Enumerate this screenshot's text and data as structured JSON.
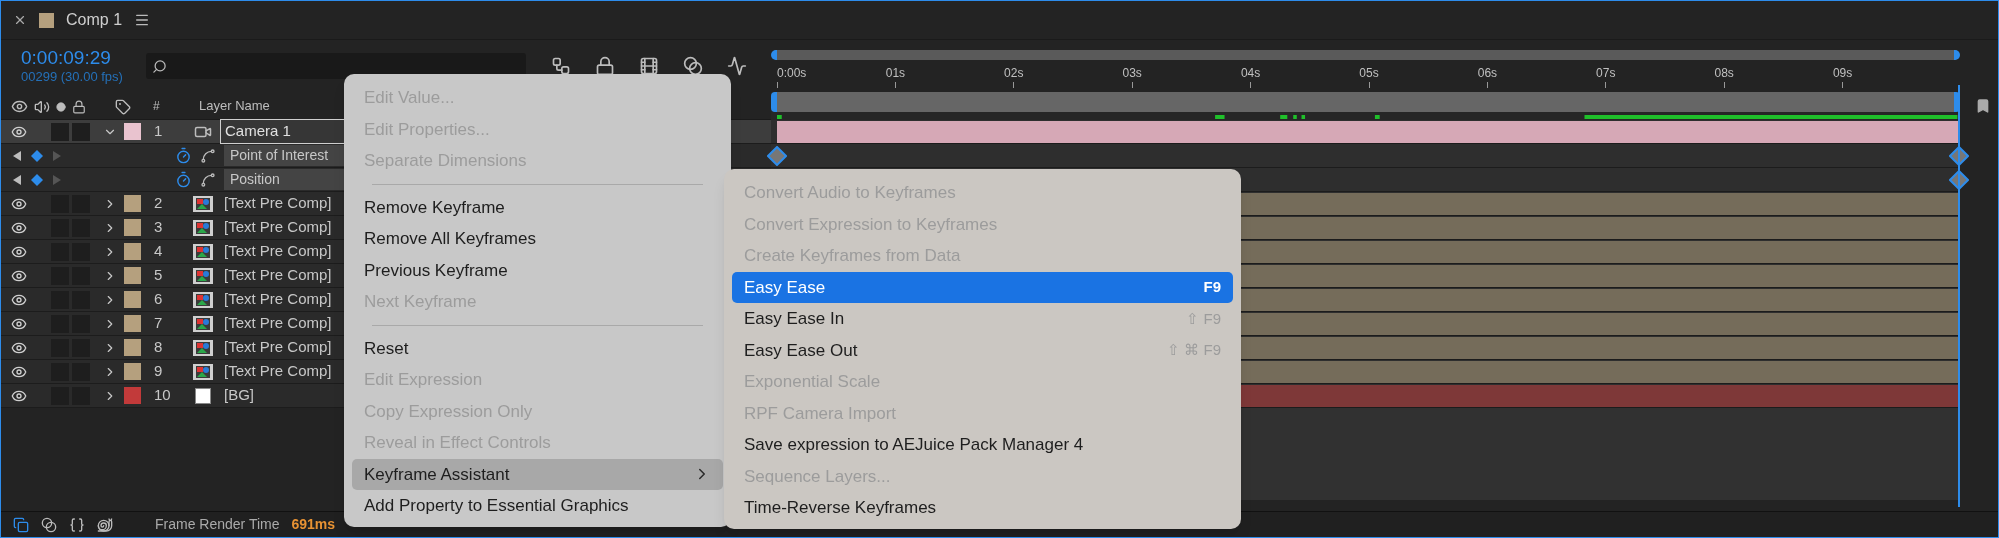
{
  "panel": {
    "title": "Comp 1"
  },
  "timecode": "0:00:09:29",
  "frame_info": "00299 (30.00 fps)",
  "columns": {
    "number": "#",
    "layer_name": "Layer Name"
  },
  "ruler": [
    "0:00s",
    "01s",
    "02s",
    "03s",
    "04s",
    "05s",
    "06s",
    "07s",
    "08s",
    "09s"
  ],
  "layers": [
    {
      "number": "1",
      "name": "Camera 1",
      "kind": "camera",
      "color": "#e9c3cf",
      "selected": true,
      "expanded": true,
      "properties": [
        {
          "name": "Point of Interest"
        },
        {
          "name": "Position"
        }
      ]
    },
    {
      "number": "2",
      "name": "[Text Pre Comp]",
      "kind": "precomp",
      "color": "#b5a07e",
      "selected": false,
      "expanded": false
    },
    {
      "number": "3",
      "name": "[Text Pre Comp]",
      "kind": "precomp",
      "color": "#b5a07e",
      "selected": false,
      "expanded": false
    },
    {
      "number": "4",
      "name": "[Text Pre Comp]",
      "kind": "precomp",
      "color": "#b5a07e",
      "selected": false,
      "expanded": false
    },
    {
      "number": "5",
      "name": "[Text Pre Comp]",
      "kind": "precomp",
      "color": "#b5a07e",
      "selected": false,
      "expanded": false
    },
    {
      "number": "6",
      "name": "[Text Pre Comp]",
      "kind": "precomp",
      "color": "#b5a07e",
      "selected": false,
      "expanded": false
    },
    {
      "number": "7",
      "name": "[Text Pre Comp]",
      "kind": "precomp",
      "color": "#b5a07e",
      "selected": false,
      "expanded": false
    },
    {
      "number": "8",
      "name": "[Text Pre Comp]",
      "kind": "precomp",
      "color": "#b5a07e",
      "selected": false,
      "expanded": false
    },
    {
      "number": "9",
      "name": "[Text Pre Comp]",
      "kind": "precomp",
      "color": "#b5a07e",
      "selected": false,
      "expanded": false
    },
    {
      "number": "10",
      "name": "[BG]",
      "kind": "solid",
      "color": "#c23a3a",
      "selected": false,
      "expanded": false
    }
  ],
  "status_bar": {
    "label": "Frame Render Time",
    "value": "691ms"
  },
  "context_menu": {
    "items": [
      {
        "kind": "item",
        "label": "Edit Value...",
        "disabled": true,
        "selected": false
      },
      {
        "kind": "item",
        "label": "Edit Properties...",
        "disabled": true,
        "selected": false
      },
      {
        "kind": "item",
        "label": "Separate Dimensions",
        "disabled": true,
        "selected": false
      },
      {
        "kind": "separator"
      },
      {
        "kind": "item",
        "label": "Remove Keyframe",
        "disabled": false,
        "selected": false
      },
      {
        "kind": "item",
        "label": "Remove All Keyframes",
        "disabled": false,
        "selected": false
      },
      {
        "kind": "item",
        "label": "Previous Keyframe",
        "disabled": false,
        "selected": false
      },
      {
        "kind": "item",
        "label": "Next Keyframe",
        "disabled": true,
        "selected": false
      },
      {
        "kind": "separator"
      },
      {
        "kind": "item",
        "label": "Reset",
        "disabled": false,
        "selected": false
      },
      {
        "kind": "item",
        "label": "Edit Expression",
        "disabled": true,
        "selected": false
      },
      {
        "kind": "item",
        "label": "Copy Expression Only",
        "disabled": true,
        "selected": false
      },
      {
        "kind": "item",
        "label": "Reveal in Effect Controls",
        "disabled": true,
        "selected": false
      },
      {
        "kind": "submenu",
        "label": "Keyframe Assistant",
        "disabled": false,
        "selected": true
      },
      {
        "kind": "item",
        "label": "Add Property to Essential Graphics",
        "disabled": false,
        "selected": false
      }
    ]
  },
  "submenu": {
    "items": [
      {
        "kind": "item",
        "label": "Convert Audio to Keyframes",
        "disabled": true,
        "selected": false
      },
      {
        "kind": "item",
        "label": "Convert Expression to Keyframes",
        "disabled": true,
        "selected": false
      },
      {
        "kind": "item",
        "label": "Create Keyframes from Data",
        "disabled": true,
        "selected": false
      },
      {
        "kind": "item",
        "label": "Easy Ease",
        "disabled": false,
        "selected": true,
        "shortcut": "F9"
      },
      {
        "kind": "item",
        "label": "Easy Ease In",
        "disabled": false,
        "selected": false,
        "shortcut": "⇧ F9"
      },
      {
        "kind": "item",
        "label": "Easy Ease Out",
        "disabled": false,
        "selected": false,
        "shortcut": "⇧ ⌘ F9"
      },
      {
        "kind": "item",
        "label": "Exponential Scale",
        "disabled": true,
        "selected": false
      },
      {
        "kind": "item",
        "label": "RPF Camera Import",
        "disabled": true,
        "selected": false
      },
      {
        "kind": "item",
        "label": "Save expression to AEJuice Pack Manager 4",
        "disabled": false,
        "selected": false
      },
      {
        "kind": "item",
        "label": "Sequence Layers...",
        "disabled": true,
        "selected": false
      },
      {
        "kind": "item",
        "label": "Time-Reverse Keyframes",
        "disabled": false,
        "selected": false
      }
    ]
  }
}
